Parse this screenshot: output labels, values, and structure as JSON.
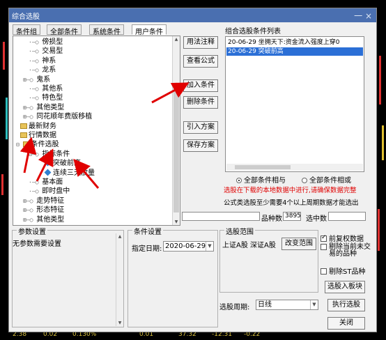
{
  "window": {
    "title": "综合选股",
    "close": "一 ×"
  },
  "tabs": [
    {
      "label": "条件组",
      "active": false
    },
    {
      "label": "全部条件",
      "active": false
    },
    {
      "label": "系统条件",
      "active": false
    },
    {
      "label": "用户条件",
      "active": true
    }
  ],
  "tree": [
    {
      "prefix": "·–○ ",
      "label": "傍损型",
      "indent": 22,
      "icon": "none"
    },
    {
      "prefix": "·–○ ",
      "label": "交易型",
      "indent": 22,
      "icon": "none"
    },
    {
      "prefix": "·–○ ",
      "label": "神系",
      "indent": 22,
      "icon": "none"
    },
    {
      "prefix": "·–○ ",
      "label": "龙系",
      "indent": 22,
      "icon": "none"
    },
    {
      "prefix": "⊞–○ ",
      "label": "鬼系",
      "indent": 14,
      "icon": "none"
    },
    {
      "prefix": "·–○ ",
      "label": "其他系",
      "indent": 22,
      "icon": "none"
    },
    {
      "prefix": "·–○ ",
      "label": "特色型",
      "indent": 22,
      "icon": "none"
    },
    {
      "prefix": "⊞–○ ",
      "label": "其他类型",
      "indent": 14,
      "icon": "none"
    },
    {
      "prefix": "⊞–○ ",
      "label": "同花顺年费版移植",
      "indent": 14,
      "icon": "none"
    },
    {
      "prefix": "",
      "label": "最新财务",
      "indent": 10,
      "icon": "folder"
    },
    {
      "prefix": "",
      "label": "行情数据",
      "indent": 10,
      "icon": "folder"
    },
    {
      "prefix": "⊟ ",
      "label": "条件选股",
      "indent": 4,
      "icon": "folder"
    },
    {
      "prefix": "⊟–○ ",
      "label": "指标条件",
      "indent": 22,
      "icon": "none"
    },
    {
      "prefix": "",
      "label": "突破前高",
      "indent": 44,
      "icon": "gem"
    },
    {
      "prefix": "",
      "label": "连续三天放量",
      "indent": 44,
      "icon": "gem"
    },
    {
      "prefix": "·–○ ",
      "label": "基本面",
      "indent": 22,
      "icon": "none"
    },
    {
      "prefix": "·–○ ",
      "label": "即时盘中",
      "indent": 22,
      "icon": "none"
    },
    {
      "prefix": "⊞–○ ",
      "label": "走势特征",
      "indent": 14,
      "icon": "none"
    },
    {
      "prefix": "⊞–○ ",
      "label": "形态特征",
      "indent": 14,
      "icon": "none"
    },
    {
      "prefix": "⊞–○ ",
      "label": "其他类型",
      "indent": 14,
      "icon": "none"
    }
  ],
  "buttons": {
    "usage": "用法注释",
    "view_formula": "查看公式",
    "add_condition": "加入条件",
    "delete_condition": "删除条件",
    "import_scheme": "引入方案",
    "save_scheme": "保存方案",
    "change_range": "改变范围",
    "select_to_block": "选股入板块",
    "execute": "执行选股",
    "close": "关闭"
  },
  "condition_list": {
    "title": "组合选股条件列表",
    "items": [
      {
        "text": "20-06-29 坐拥天下:资金流入强度上穿0",
        "selected": false
      },
      {
        "text": "20-06-29 突破前高",
        "selected": true
      }
    ]
  },
  "logic": {
    "and_label": "全部条件相与",
    "or_label": "全部条件相或",
    "and_selected": true
  },
  "notes": {
    "line1": "选股在下载的本地数据中进行,请确保数据完整",
    "line2": "公式类选股至少需要4个以上周期数据才能选出"
  },
  "counts": {
    "total_label": "品种数",
    "total_value": "3895",
    "selected_label": "选中数",
    "selected_value": ""
  },
  "params": {
    "title": "参数设置",
    "text": "无参数需要设置"
  },
  "cond_settings": {
    "title": "条件设置",
    "date_label": "指定日期:",
    "date_value": "2020-06-29"
  },
  "range": {
    "title": "选股范围",
    "text": "上证A股 深证A股"
  },
  "options": [
    {
      "label": "前复权数据",
      "checked": true
    },
    {
      "label": "剔除当前未交易的品种",
      "checked": false
    },
    {
      "label": "剔除ST品种",
      "checked": false
    }
  ],
  "period": {
    "label": "选股周期:",
    "value": "日线"
  },
  "bg_ticks": [
    "2.38",
    "0.02",
    "0.130%",
    "0.01",
    "37.32",
    "-12.31",
    "-0.22"
  ]
}
